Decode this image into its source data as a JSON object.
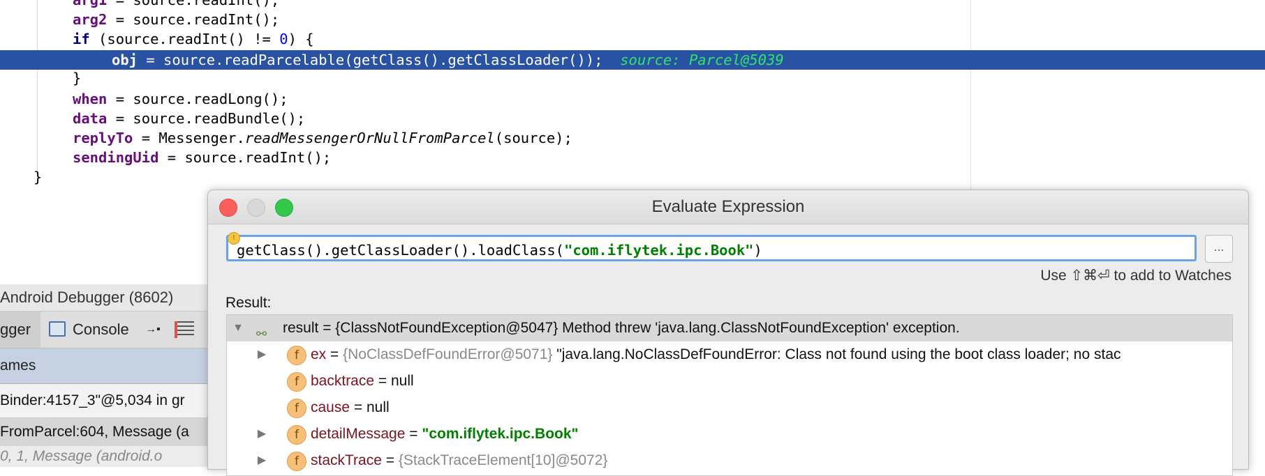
{
  "editor": {
    "lines": [
      {
        "name": "line-arg1",
        "parts": [
          [
            "fld",
            "arg1"
          ],
          [
            "",
            "= source.readInt();"
          ]
        ]
      },
      {
        "name": "line-arg2",
        "parts": [
          [
            "fld",
            "arg2"
          ],
          [
            "",
            "= source.readInt();"
          ]
        ]
      },
      {
        "name": "line-if",
        "parts": [
          [
            "kw",
            "if"
          ],
          [
            "",
            "(source.readInt() != "
          ],
          [
            "num",
            "0"
          ],
          [
            "",
            ") {"
          ]
        ]
      },
      {
        "name": "line-obj",
        "parts": [
          [
            "fld",
            "obj"
          ],
          [
            "",
            "= source.readParcelable(getClass().getClassLoader());"
          ]
        ]
      },
      {
        "name": "line-close-if",
        "parts": [
          [
            "",
            "}"
          ]
        ]
      },
      {
        "name": "line-when",
        "parts": [
          [
            "fld",
            "when"
          ],
          [
            "",
            "= source.readLong();"
          ]
        ]
      },
      {
        "name": "line-data",
        "parts": [
          [
            "fld",
            "data"
          ],
          [
            "",
            "= source.readBundle();"
          ]
        ]
      },
      {
        "name": "line-replyto",
        "parts": [
          [
            "fld",
            "replyTo"
          ],
          [
            "",
            "= Messenger."
          ],
          [
            "ital",
            "readMessengerOrNullFromParcel"
          ],
          [
            "",
            "(source);"
          ]
        ]
      },
      {
        "name": "line-sendinguid",
        "parts": [
          [
            "fld",
            "sendingUid"
          ],
          [
            "",
            "= source.readInt();"
          ]
        ]
      },
      {
        "name": "line-close-method",
        "parts": [
          [
            "",
            "}"
          ]
        ]
      }
    ],
    "inline_value": "source: Parcel@5039"
  },
  "debug_panel": {
    "title": "Android Debugger (8602)",
    "tab_debugger": "gger",
    "tab_console": "Console",
    "frames_header": "ames",
    "thread": "Binder:4157_3\"@5,034 in gr",
    "frame_selected": "FromParcel:604, Message (a",
    "frame_next": "0, 1, Message (android.o"
  },
  "dialog": {
    "title": "Evaluate Expression",
    "expression_a": "getClass().getClassLoader().loadClass(",
    "expression_str": "\"com.iflytek.ipc.Book\"",
    "expression_b": ")",
    "more_label": "...",
    "hint": "Use ⇧⌘⏎ to add to Watches",
    "result_label": "Result:",
    "result": {
      "root_name": "result",
      "root_value": " = {ClassNotFoundException@5047} Method threw 'java.lang.ClassNotFoundException' exception.",
      "children": [
        {
          "name": "ex",
          "ref": " {NoClassDefFoundError@5071}",
          "value": " \"java.lang.NoClassDefFoundError: Class not found using the boot class loader; no stac",
          "expandable": true
        },
        {
          "name": "backtrace",
          "ref": "",
          "value": " = null",
          "expandable": false
        },
        {
          "name": "cause",
          "ref": "",
          "value": " = null",
          "expandable": false
        },
        {
          "name": "detailMessage",
          "ref": "",
          "value": "\"com.iflytek.ipc.Book\"",
          "expandable": true
        },
        {
          "name": "stackTrace",
          "ref": " {StackTraceElement[10]@5072}",
          "value": "",
          "expandable": true
        }
      ]
    }
  },
  "colors": {
    "highlight_line": "#2a52a3",
    "inline_value": "#2ee56c",
    "string": "#007f00",
    "field": "#660e7a",
    "keyword": "#000080"
  }
}
